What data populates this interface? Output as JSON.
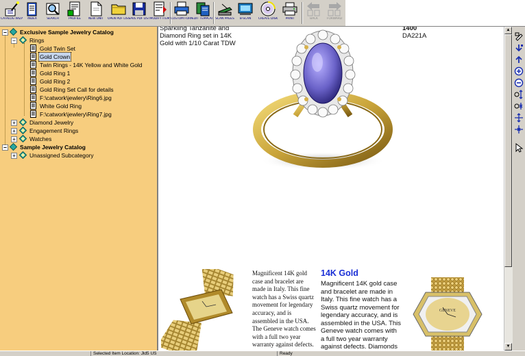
{
  "toolbar": {
    "buttons": [
      {
        "id": "catalog-wizard",
        "label": "Catalog Wizard",
        "icon": "wand-icon"
      },
      {
        "id": "index",
        "label": "Index",
        "icon": "book-icon"
      },
      {
        "id": "search",
        "label": "Search",
        "icon": "magnifier-icon"
      },
      {
        "id": "profile",
        "label": "Profile",
        "icon": "profile-icon"
      },
      {
        "id": "new-unit",
        "label": "New Unit",
        "icon": "new-page-icon"
      },
      {
        "id": "open-pdf-list",
        "label": "Open Pdf List",
        "icon": "folder-icon"
      },
      {
        "id": "save-pdf-list",
        "label": "Save Pdf List",
        "icon": "floppy-icon"
      },
      {
        "id": "modify-item",
        "label": "Modify Item",
        "icon": "edit-list-icon"
      },
      {
        "id": "custom-format",
        "label": "Custom Format",
        "icon": "printer-icon"
      },
      {
        "id": "edit-template",
        "label": "Edit Template",
        "icon": "template-icon"
      },
      {
        "id": "scan-pages",
        "label": "Scan Pages",
        "icon": "scanner-icon"
      },
      {
        "id": "b-scan",
        "label": "B-Scan",
        "icon": "batch-scan-icon"
      },
      {
        "id": "create-disk",
        "label": "Create Disk",
        "icon": "cd-icon"
      },
      {
        "id": "print",
        "label": "Print",
        "icon": "print-icon"
      },
      {
        "id": "back",
        "label": "Back",
        "icon": "back-arrow-icon"
      },
      {
        "id": "forward",
        "label": "Forward",
        "icon": "forward-arrow-icon"
      }
    ]
  },
  "tree": {
    "catalog1": "Exclusive Sample Jewelry Catalog",
    "rings": "Rings",
    "ring_items": [
      "Gold Twin Set",
      "Gold Crown",
      "Twin Rings - 14K Yellow and White Gold",
      "Gold Ring 1",
      "Gold Ring 2",
      "Gold Ring Set Call for details",
      "F:\\catwork\\jewlery\\Ring6.jpg",
      "White Gold Ring",
      "F:\\catwork\\jewlery\\Ring7.jpg"
    ],
    "diamond": "Diamond Jewelry",
    "engagement": "Engagement Rings",
    "watches": "Watches",
    "catalog2": "Sample Jewelry Catalog",
    "unassigned": "Unassigned Subcategory"
  },
  "page": {
    "ring_desc": "Sparkling Tanzanite and\nDiamond Ring set in 14K\nGold with 1/10 Carat TDW",
    "ring_price": "1400",
    "ring_sku": "DA221A",
    "watch_desc_left": "Magnificent 14K gold case and bracelet are made in Italy. This fine watch has a Swiss quartz movement for legendary accuracy, and is assembled in the USA. The Geneve watch comes with a full two year warranty against defects.",
    "watch_heading": "14K Gold",
    "watch_desc_right": "Magnificent 14K gold case and bracelet are made in Italy. This fine watch has a Swiss quartz movement for legendary accuracy, and is assembled in the USA. This Geneve watch comes with a full two year warranty against defects. Diamonds",
    "watch_face_brand": "GENEVE"
  },
  "status": {
    "cell1": "",
    "cell2": "Selected Item Location: Jld5 US",
    "cell3": "Ready"
  },
  "colors": {
    "tree_bg": "#f7cd7e",
    "heading_blue": "#1a2fd6",
    "gold": "#c9a43a",
    "tanzanite": "#6a62c8"
  }
}
